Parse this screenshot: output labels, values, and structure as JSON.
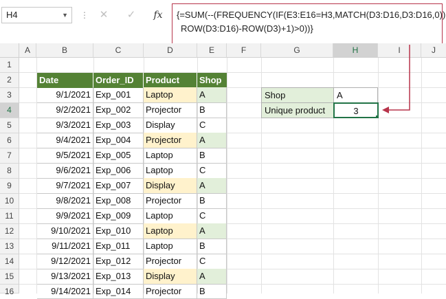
{
  "name_box": {
    "value": "H4"
  },
  "formula_bar": {
    "fx_label": "fx",
    "cancel_glyph": "✕",
    "enter_glyph": "✓",
    "lines": [
      "{=SUM(--(FREQUENCY(IF(E3:E16=H3,MATCH(D3:D16,D3:D16,0)),",
      "ROW(D3:D16)-ROW(D3)+1)>0))}"
    ]
  },
  "columns": [
    "A",
    "B",
    "C",
    "D",
    "E",
    "F",
    "G",
    "H",
    "I",
    "J"
  ],
  "rows": [
    "1",
    "2",
    "3",
    "4",
    "5",
    "6",
    "7",
    "8",
    "9",
    "10",
    "11",
    "12",
    "13",
    "14",
    "15",
    "16"
  ],
  "table": {
    "headers": [
      "Date",
      "Order_ID",
      "Product",
      "Shop"
    ],
    "rows": [
      {
        "date": "9/1/2021",
        "id": "Exp_001",
        "product": "Laptop",
        "shop": "A"
      },
      {
        "date": "9/2/2021",
        "id": "Exp_002",
        "product": "Projector",
        "shop": "B"
      },
      {
        "date": "9/3/2021",
        "id": "Exp_003",
        "product": "Display",
        "shop": "C"
      },
      {
        "date": "9/4/2021",
        "id": "Exp_004",
        "product": "Projector",
        "shop": "A"
      },
      {
        "date": "9/5/2021",
        "id": "Exp_005",
        "product": "Laptop",
        "shop": "B"
      },
      {
        "date": "9/6/2021",
        "id": "Exp_006",
        "product": "Laptop",
        "shop": "C"
      },
      {
        "date": "9/7/2021",
        "id": "Exp_007",
        "product": "Display",
        "shop": "A"
      },
      {
        "date": "9/8/2021",
        "id": "Exp_008",
        "product": "Projector",
        "shop": "B"
      },
      {
        "date": "9/9/2021",
        "id": "Exp_009",
        "product": "Laptop",
        "shop": "C"
      },
      {
        "date": "9/10/2021",
        "id": "Exp_010",
        "product": "Laptop",
        "shop": "A"
      },
      {
        "date": "9/11/2021",
        "id": "Exp_011",
        "product": "Laptop",
        "shop": "B"
      },
      {
        "date": "9/12/2021",
        "id": "Exp_012",
        "product": "Projector",
        "shop": "C"
      },
      {
        "date": "9/13/2021",
        "id": "Exp_013",
        "product": "Display",
        "shop": "A"
      },
      {
        "date": "9/14/2021",
        "id": "Exp_014",
        "product": "Projector",
        "shop": "B"
      }
    ]
  },
  "lookup": {
    "shop_label": "Shop",
    "shop_value": "A",
    "unique_label": "Unique product",
    "unique_value": "3"
  },
  "colors": {
    "header_green": "#548235",
    "highlight_yellow": "#fff2cc",
    "highlight_green": "#e2efda",
    "arrow_red": "#b7334a",
    "selection_green": "#217346"
  }
}
